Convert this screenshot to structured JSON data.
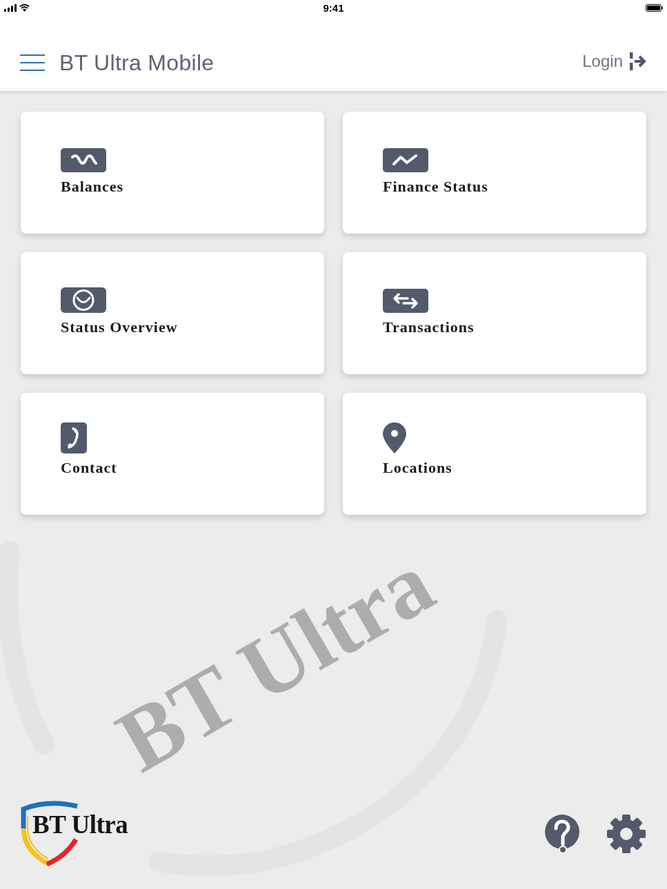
{
  "status_bar": {
    "time": "9:41"
  },
  "header": {
    "title": "BT Ultra Mobile",
    "login_label": "Login"
  },
  "tiles": [
    {
      "label": "Balances"
    },
    {
      "label": "Finance Status"
    },
    {
      "label": "Status Overview"
    },
    {
      "label": "Transactions"
    },
    {
      "label": "Contact"
    },
    {
      "label": "Locations"
    }
  ],
  "background_mark": {
    "text": "BT Ultra"
  },
  "footer": {
    "logo_text": "BT Ultra"
  }
}
